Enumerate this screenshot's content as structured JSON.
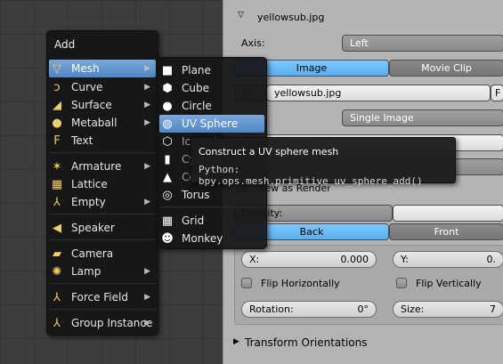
{
  "panel": {
    "image_name": "yellowsub.jpg",
    "axis_label": "Axis:",
    "axis_value": "Left",
    "source_tabs": [
      "Image",
      "Movie Clip"
    ],
    "file_name": "yellowsub.jpg",
    "file_suffix": "F",
    "source_label": "e:",
    "source_value": "Single Image",
    "image_field_partial": "yellowsub.jpg",
    "view_as_render": "View as Render",
    "opacity_label": "Opacity:",
    "side_tabs": [
      "Back",
      "Front"
    ],
    "x_label": "X:",
    "x_value": "0.000",
    "y_label": "Y:",
    "y_value": "0.",
    "flip_h": "Flip Horizontally",
    "flip_v": "Flip Vertically",
    "rotation_label": "Rotation:",
    "rotation_value": "0°",
    "size_label": "Size:",
    "size_value": "7",
    "transform_orientations": "Transform Orientations"
  },
  "add_menu": {
    "title": "Add",
    "items": [
      {
        "label": "Mesh",
        "icon": "mesh-icon"
      },
      {
        "label": "Curve",
        "icon": "curve-icon"
      },
      {
        "label": "Surface",
        "icon": "surface-icon"
      },
      {
        "label": "Metaball",
        "icon": "metaball-icon"
      },
      {
        "label": "Text",
        "icon": "text-icon"
      },
      {
        "label": "Armature",
        "icon": "armature-icon"
      },
      {
        "label": "Lattice",
        "icon": "lattice-icon"
      },
      {
        "label": "Empty",
        "icon": "empty-icon"
      },
      {
        "label": "Speaker",
        "icon": "speaker-icon"
      },
      {
        "label": "Camera",
        "icon": "camera-icon"
      },
      {
        "label": "Lamp",
        "icon": "lamp-icon"
      },
      {
        "label": "Force Field",
        "icon": "force-field-icon"
      },
      {
        "label": "Group Instance",
        "icon": "group-instance-icon"
      }
    ]
  },
  "mesh_menu": {
    "items": [
      {
        "label": "Plane"
      },
      {
        "label": "Cube"
      },
      {
        "label": "Circle"
      },
      {
        "label": "UV Sphere"
      },
      {
        "label": "Ico Sphere"
      },
      {
        "label": "Cylinder"
      },
      {
        "label": "Cone"
      },
      {
        "label": "Torus"
      },
      {
        "label": "Grid"
      },
      {
        "label": "Monkey"
      }
    ]
  },
  "tooltip": {
    "title": "Construct a UV sphere mesh",
    "python": "Python: bpy.ops.mesh.primitive_uv_sphere_add()"
  }
}
